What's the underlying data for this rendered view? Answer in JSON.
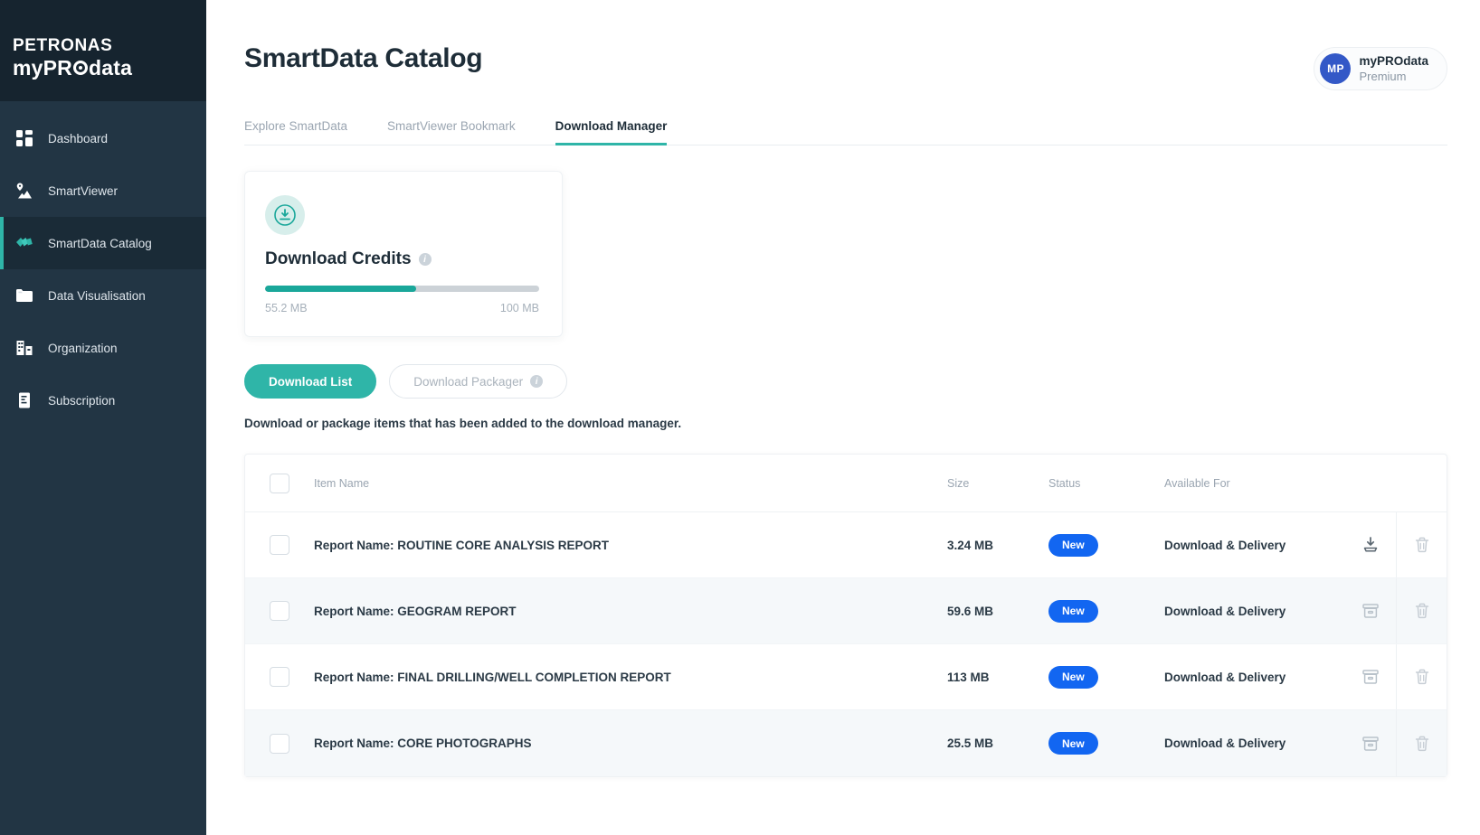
{
  "brand": {
    "line1": "PETRONAS",
    "line2_pre": "myPR",
    "line2_post": "data",
    "o_icon": "target-o-icon"
  },
  "sidebar": {
    "items": [
      {
        "label": "Dashboard",
        "icon": "grid-dashboard-icon",
        "active": false
      },
      {
        "label": "SmartViewer",
        "icon": "map-pin-image-icon",
        "active": false
      },
      {
        "label": "SmartData Catalog",
        "icon": "cards-fan-icon",
        "active": true
      },
      {
        "label": "Data Visualisation",
        "icon": "folder-icon",
        "active": false
      },
      {
        "label": "Organization",
        "icon": "buildings-chart-icon",
        "active": false
      },
      {
        "label": "Subscription",
        "icon": "document-list-icon",
        "active": false
      }
    ]
  },
  "header": {
    "title": "SmartData Catalog",
    "profile": {
      "initials": "MP",
      "name": "myPROdata",
      "plan": "Premium"
    }
  },
  "tabs": [
    {
      "label": "Explore SmartData",
      "active": false
    },
    {
      "label": "SmartViewer Bookmark",
      "active": false
    },
    {
      "label": "Download Manager",
      "active": true
    }
  ],
  "credits": {
    "icon": "download-circle-icon",
    "title": "Download Credits",
    "info_icon": "info-icon",
    "used_label": "55.2 MB",
    "total_label": "100 MB",
    "percent": 55.2
  },
  "segmented": {
    "primary": {
      "label": "Download List",
      "active": true
    },
    "secondary": {
      "label": "Download Packager",
      "active": false,
      "info_icon": "info-icon"
    }
  },
  "description": "Download or package items that has been added to the download manager.",
  "table": {
    "columns": {
      "item_name": "Item Name",
      "size": "Size",
      "status": "Status",
      "available_for": "Available For"
    },
    "rows": [
      {
        "name": "Report Name: ROUTINE CORE ANALYSIS REPORT",
        "size": "3.24 MB",
        "status": "New",
        "available_for": "Download & Delivery",
        "action_icon": "download-tray-icon",
        "delete_icon": "trash-icon",
        "alt": false
      },
      {
        "name": "Report Name: GEOGRAM REPORT",
        "size": "59.6 MB",
        "status": "New",
        "available_for": "Download & Delivery",
        "action_icon": "archive-box-icon",
        "delete_icon": "trash-icon",
        "alt": true
      },
      {
        "name": "Report Name: FINAL DRILLING/WELL COMPLETION REPORT",
        "size": "113 MB",
        "status": "New",
        "available_for": "Download & Delivery",
        "action_icon": "archive-box-icon",
        "delete_icon": "trash-icon",
        "alt": false
      },
      {
        "name": "Report Name: CORE PHOTOGRAPHS",
        "size": "25.5 MB",
        "status": "New",
        "available_for": "Download & Delivery",
        "action_icon": "archive-box-icon",
        "delete_icon": "trash-icon",
        "alt": true
      }
    ]
  },
  "colors": {
    "sidebar_bg": "#223544",
    "brand_bg": "#16242f",
    "accent_teal": "#2fb5a8",
    "progress_teal": "#1aa79a",
    "badge_blue": "#1266f1",
    "avatar_blue": "#3358c7",
    "text_dark": "#1e2d38",
    "text_muted": "#9aa5b1"
  }
}
